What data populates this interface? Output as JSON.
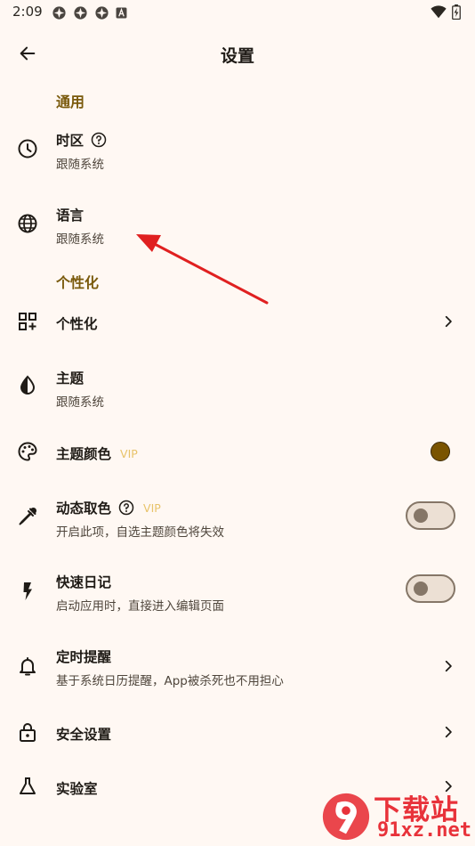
{
  "status_bar": {
    "time": "2:09"
  },
  "app_bar": {
    "title": "设置"
  },
  "sections": {
    "general": "通用",
    "personalization": "个性化"
  },
  "rows": {
    "timezone": {
      "title": "时区",
      "subtitle": "跟随系统",
      "icon": "clock-icon"
    },
    "language": {
      "title": "语言",
      "subtitle": "跟随系统",
      "icon": "globe-icon"
    },
    "personalize": {
      "title": "个性化",
      "icon": "widgets-icon"
    },
    "theme": {
      "title": "主题",
      "subtitle": "跟随系统",
      "icon": "contrast-icon"
    },
    "theme_color": {
      "title": "主题颜色",
      "badge": "VIP",
      "icon": "palette-icon",
      "color": "#7a5400"
    },
    "dynamic_color": {
      "title": "动态取色",
      "badge": "VIP",
      "subtitle": "开启此项，自选主题颜色将失效",
      "icon": "eyedropper-icon",
      "enabled": false
    },
    "quick_diary": {
      "title": "快速日记",
      "subtitle": "启动应用时，直接进入编辑页面",
      "icon": "bolt-icon",
      "enabled": false
    },
    "reminder": {
      "title": "定时提醒",
      "subtitle": "基于系统日历提醒，App被杀死也不用担心",
      "icon": "bell-icon"
    },
    "security": {
      "title": "安全设置",
      "icon": "lock-icon"
    },
    "lab": {
      "title": "实验室",
      "icon": "flask-icon"
    }
  },
  "watermark": {
    "top": "下载站",
    "bottom": "91xz.net"
  },
  "colors": {
    "background": "#fff8f3",
    "section": "#7a5a0c",
    "vip": "#e8c36a",
    "annotation_arrow": "#e02020"
  }
}
